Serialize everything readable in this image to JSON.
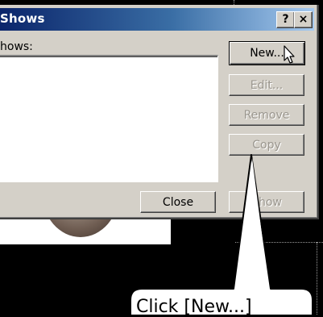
{
  "dialog": {
    "title": "Shows",
    "help_button": "?",
    "close_button": "×",
    "list_label": "hows:"
  },
  "buttons": {
    "new": "New...",
    "edit": "Edit...",
    "remove": "Remove",
    "copy": "Copy",
    "close": "Close",
    "show": "Show"
  },
  "callout": {
    "text": "Click [New...]"
  },
  "colors": {
    "title_start": "#0a246a",
    "title_end": "#a6caf0",
    "face": "#d4d0c8"
  }
}
